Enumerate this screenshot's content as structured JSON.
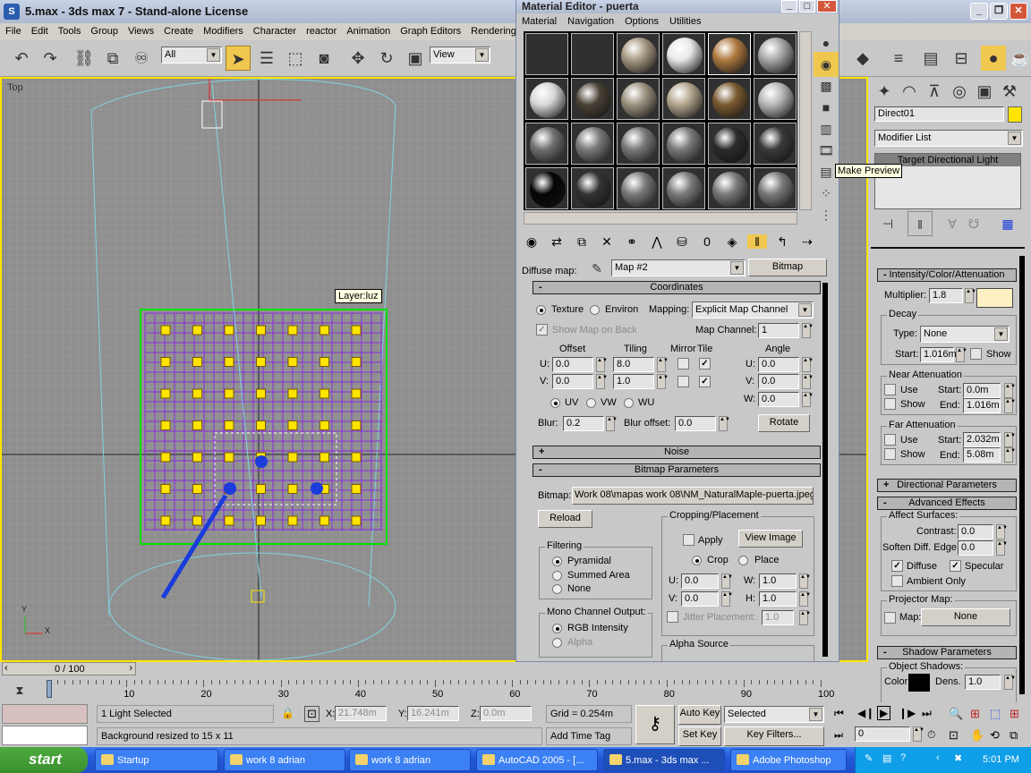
{
  "app": {
    "title": "5.max - 3ds max 7  - Stand-alone License"
  },
  "menu": [
    "File",
    "Edit",
    "Tools",
    "Group",
    "Views",
    "Create",
    "Modifiers",
    "Character",
    "reactor",
    "Animation",
    "Graph Editors",
    "Rendering"
  ],
  "toolbar": {
    "selection_filter": "All",
    "reference_coord": "View"
  },
  "viewport": {
    "label": "Top",
    "tooltip": "Layer:luz",
    "axis_x": "X",
    "axis_y": "Y"
  },
  "material_editor": {
    "title": "Material Editor - puerta",
    "menu": [
      "Material",
      "Navigation",
      "Options",
      "Utilities"
    ],
    "slot_colors": [
      "#303030",
      "#303030",
      "#a89a84",
      "#e8e8e8",
      "#b07a40",
      "#a8a8a8",
      "#d8d8d8",
      "#4a4236",
      "#9c9280",
      "#b4a68e",
      "#7a5a30",
      "#b8b8b8",
      "#707070",
      "#7a7a7a",
      "#7a7a7a",
      "#7a7a7a",
      "#2c2c2c",
      "#3a3a3a",
      "#050505",
      "#333333",
      "#7a7a7a",
      "#7a7a7a",
      "#7a7a7a",
      "#7a7a7a"
    ],
    "tooltip": "Make Preview",
    "diffuse_label": "Diffuse map:",
    "map_name": "Map #2",
    "map_type": "Bitmap",
    "coordinates": {
      "title": "Coordinates",
      "texture": "Texture",
      "environ": "Environ",
      "mapping_label": "Mapping:",
      "mapping": "Explicit Map Channel",
      "show_map_on_back": "Show Map on Back",
      "map_channel_label": "Map Channel:",
      "map_channel": "1",
      "offset": "Offset",
      "tiling": "Tiling",
      "mirror": "Mirror",
      "tile": "Tile",
      "angle": "Angle",
      "u": "U:",
      "v": "V:",
      "w": "W:",
      "offset_u": "0.0",
      "offset_v": "0.0",
      "tiling_u": "8.0",
      "tiling_v": "1.0",
      "angle_u": "0.0",
      "angle_v": "0.0",
      "angle_w": "0.0",
      "uv": "UV",
      "vw": "VW",
      "wu": "WU",
      "blur_label": "Blur:",
      "blur": "0.2",
      "blur_offset_label": "Blur offset:",
      "blur_offset": "0.0",
      "rotate": "Rotate"
    },
    "noise": {
      "title": "Noise"
    },
    "bitmap": {
      "title": "Bitmap Parameters",
      "label": "Bitmap:",
      "path": "Work 08\\mapas work 08\\NM_NaturalMaple-puerta.jpeg",
      "reload": "Reload",
      "filtering": "Filtering",
      "pyramidal": "Pyramidal",
      "summed": "Summed Area",
      "none": "None",
      "mono": "Mono Channel Output:",
      "rgb": "RGB Intensity",
      "alpha": "Alpha",
      "cropping": "Cropping/Placement",
      "apply": "Apply",
      "view_image": "View Image",
      "crop": "Crop",
      "place": "Place",
      "u": "U:",
      "v": "V:",
      "w": "W:",
      "h": "H:",
      "cu": "0.0",
      "cv": "0.0",
      "cw": "1.0",
      "ch": "1.0",
      "jitter": "Jitter Placement:",
      "jitter_val": "1.0",
      "alpha_source": "Alpha Source"
    }
  },
  "command_panel": {
    "object_name": "Direct01",
    "object_color": "#ffe400",
    "modifier_list": "Modifier List",
    "stack_item": "Target Directional Light",
    "intensity": {
      "title": "Intensity/Color/Attenuation",
      "multiplier_label": "Multiplier:",
      "multiplier": "1.8",
      "light_color": "#fff0c4",
      "decay": "Decay",
      "type_label": "Type:",
      "type": "None",
      "start_label": "Start:",
      "start": "1.016m",
      "show": "Show",
      "near": "Near Attenuation",
      "far": "Far Attenuation",
      "use": "Use",
      "end_label": "End:",
      "near_start": "0.0m",
      "near_end": "1.016m",
      "far_start": "2.032m",
      "far_end": "5.08m"
    },
    "directional": "Directional Parameters",
    "advanced": {
      "title": "Advanced Effects",
      "affect": "Affect Surfaces:",
      "contrast_label": "Contrast:",
      "contrast": "0.0",
      "soften_label": "Soften Diff. Edge:",
      "soften": "0.0",
      "diffuse": "Diffuse",
      "specular": "Specular",
      "ambient": "Ambient Only",
      "projector": "Projector Map:",
      "map": "Map:",
      "none": "None"
    },
    "shadow": {
      "title": "Shadow Parameters",
      "object_shadows": "Object Shadows:",
      "color_label": "Color:",
      "dens_label": "Dens.",
      "dens": "1.0"
    }
  },
  "timeline": {
    "frame": "0 / 100",
    "ticks": [
      "0",
      "10",
      "20",
      "30",
      "40",
      "50",
      "60",
      "70",
      "80",
      "90",
      "100"
    ]
  },
  "status": {
    "selected": "1 Light Selected",
    "prompt": "Background resized to 15 x 11",
    "x_label": "X:",
    "x": "21.748m",
    "y_label": "Y:",
    "y": "16.241m",
    "z_label": "Z:",
    "z": "0.0m",
    "grid": "Grid = 0.254m",
    "add_time_tag": "Add Time Tag",
    "auto_key": "Auto Key",
    "set_key": "Set Key",
    "key_mode": "Selected",
    "key_filters": "Key Filters...",
    "current_frame": "0"
  },
  "taskbar": {
    "start": "start",
    "tasks": [
      "Startup",
      "work 8 adrian",
      "work 8 adrian",
      "AutoCAD 2005 - [...",
      "5.max - 3ds max ...",
      "Adobe Photoshop"
    ],
    "clock": "5:01 PM"
  }
}
